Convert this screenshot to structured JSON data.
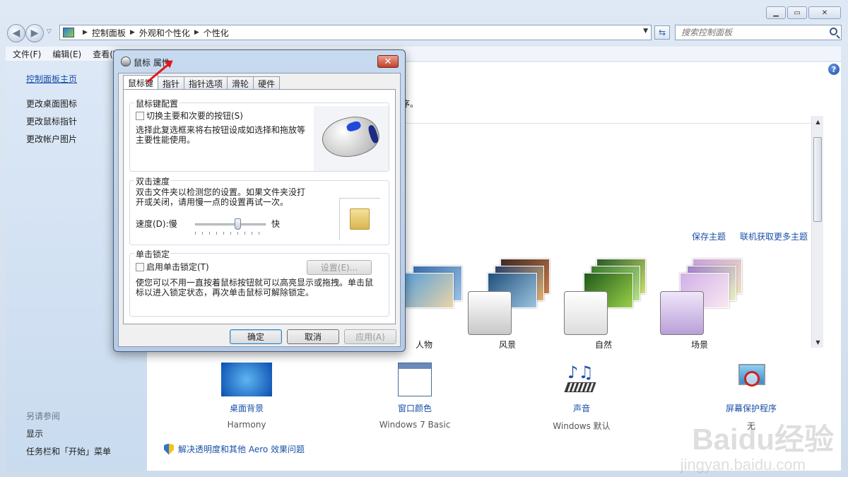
{
  "window": {
    "controls": {
      "minimize": "▁",
      "maximize": "▭",
      "close": "✕"
    }
  },
  "address": {
    "crumbs": [
      "控制面板",
      "外观和个性化",
      "个性化"
    ],
    "search_placeholder": "搜索控制面板"
  },
  "menu": [
    "文件(F)",
    "编辑(E)",
    "查看(V)"
  ],
  "sidebar": {
    "home": "控制面板主页",
    "links": [
      "更改桌面图标",
      "更改鼠标指针",
      "更改帐户图片"
    ],
    "see_also_heading": "另请参阅",
    "see_also": [
      "显示",
      "任务栏和「开始」菜单"
    ]
  },
  "main": {
    "intro_tail": "序。",
    "save_theme": "保存主题",
    "more_themes": "联机获取更多主题",
    "themes": [
      {
        "label": "人物",
        "accent": "#4f8ec8"
      },
      {
        "label": "风景",
        "accent": "#7aa3d0"
      },
      {
        "label": "自然",
        "accent": "#7bbf3a"
      },
      {
        "label": "场景",
        "accent": "#b494d8"
      }
    ],
    "bottom": [
      {
        "title": "桌面背景",
        "sub": "Harmony",
        "icon": "desktop-background-icon"
      },
      {
        "title": "窗口颜色",
        "sub": "Windows 7 Basic",
        "icon": "window-color-icon"
      },
      {
        "title": "声音",
        "sub": "Windows 默认",
        "icon": "sound-icon"
      },
      {
        "title": "屏幕保护程序",
        "sub": "无",
        "icon": "screensaver-icon"
      }
    ],
    "aero_link": "解决透明度和其他 Aero 效果问题"
  },
  "dialog": {
    "title": "鼠标 属性",
    "tabs": [
      "鼠标键",
      "指针",
      "指针选项",
      "滑轮",
      "硬件"
    ],
    "active_tab": 0,
    "button_config": {
      "label": "鼠标键配置",
      "checkbox": "切换主要和次要的按钮(S)",
      "checked": false,
      "desc": "选择此复选框来将右按钮设成如选择和拖放等主要性能使用。"
    },
    "double_click": {
      "label": "双击速度",
      "desc": "双击文件夹以检测您的设置。如果文件夹没打开或关闭，请用慢一点的设置再试一次。",
      "speed_label": "速度(D):慢",
      "fast_label": "快",
      "speed_value": 0.6
    },
    "click_lock": {
      "label": "单击锁定",
      "checkbox": "启用单击锁定(T)",
      "checked": false,
      "settings_button": "设置(E)...",
      "desc": "使您可以不用一直按着鼠标按钮就可以高亮显示或拖拽。单击鼠标以进入锁定状态，再次单击鼠标可解除锁定。"
    },
    "buttons": {
      "ok": "确定",
      "cancel": "取消",
      "apply": "应用(A)"
    }
  },
  "watermark": {
    "brand": "Baidu经验",
    "url": "jingyan.baidu.com"
  }
}
